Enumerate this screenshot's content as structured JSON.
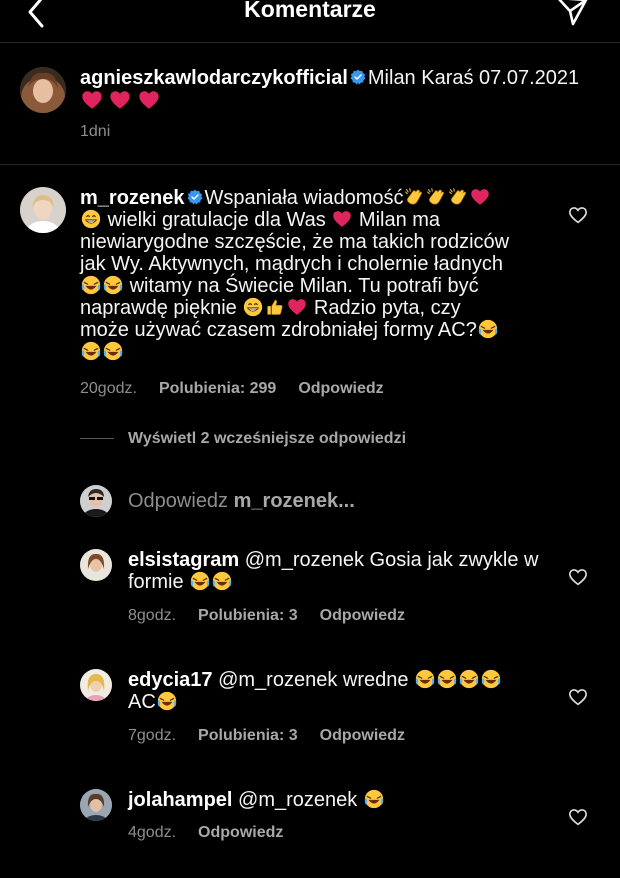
{
  "header": {
    "title": "Komentarze"
  },
  "caption": {
    "username": "agnieszkawlodarczykofficial",
    "text": "Milan Karaś 07.07.2021",
    "time": "1dni"
  },
  "main_comment": {
    "username": "m_rozenek",
    "line1": "Wspaniała wiadomość",
    "line2": "wielki gratulacje dla Was",
    "line2b": "Milan ma",
    "line3": "niewiarygodne szczęście, że ma takich rodziców",
    "line4": "jak Wy. Aktywnych, mądrych i cholernie ładnych",
    "line5": "witamy na Świecie Milan. Tu potrafi być",
    "line6": "naprawdę pięknie",
    "line6b": "Radzio pyta, czy",
    "line7": "może używać czasem zdrobniałej formy AC?",
    "time": "20godz.",
    "likes": "Polubienia: 299",
    "reply": "Odpowiedz"
  },
  "view_replies": "Wyświetl 2 wcześniejsze odpowiedzi",
  "reply_box": {
    "placeholder_prefix": "Odpowiedz",
    "placeholder_user": "m_rozenek..."
  },
  "replies": [
    {
      "username": "elsistagram",
      "line1": "@m_rozenek Gosia jak zwykle w",
      "line2": "formie",
      "time": "8godz.",
      "likes": "Polubienia: 3",
      "reply": "Odpowiedz"
    },
    {
      "username": "edycia17",
      "line1": "@m_rozenek wredne",
      "line2": "AC",
      "time": "7godz.",
      "likes": "Polubienia: 3",
      "reply": "Odpowiedz"
    },
    {
      "username": "jolahampel",
      "line1": "@m_rozenek",
      "time": "4godz.",
      "reply": "Odpowiedz"
    }
  ],
  "icons": {
    "back": "chevron-left-icon",
    "send": "paper-plane-icon",
    "heart": "heart-outline-icon",
    "verified": "verified-badge-icon"
  },
  "colors": {
    "background": "#000000",
    "text": "#f5f5f5",
    "meta": "#8e8e8e",
    "verified": "#3897f0",
    "heart_emoji": "#e0245e"
  }
}
